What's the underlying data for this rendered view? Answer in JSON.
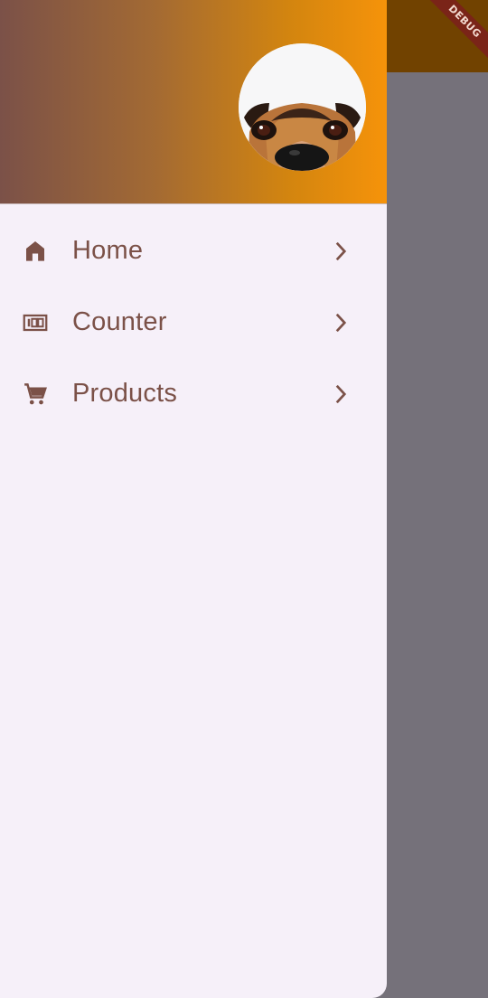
{
  "debug_banner": {
    "label": "DEBUG"
  },
  "drawer": {
    "header": {
      "avatar_alt": "dog-avatar"
    },
    "items": [
      {
        "icon": "home-icon",
        "label": "Home"
      },
      {
        "icon": "counter-icon",
        "label": "Counter"
      },
      {
        "icon": "cart-icon",
        "label": "Products"
      }
    ]
  },
  "colors": {
    "accent": "#7b5148",
    "header_gradient_start": "#7b5148",
    "header_gradient_end": "#f6930a",
    "drawer_bg": "#f6f0f9",
    "scrim": "#75717a",
    "appbar_dimmed": "#714200"
  }
}
